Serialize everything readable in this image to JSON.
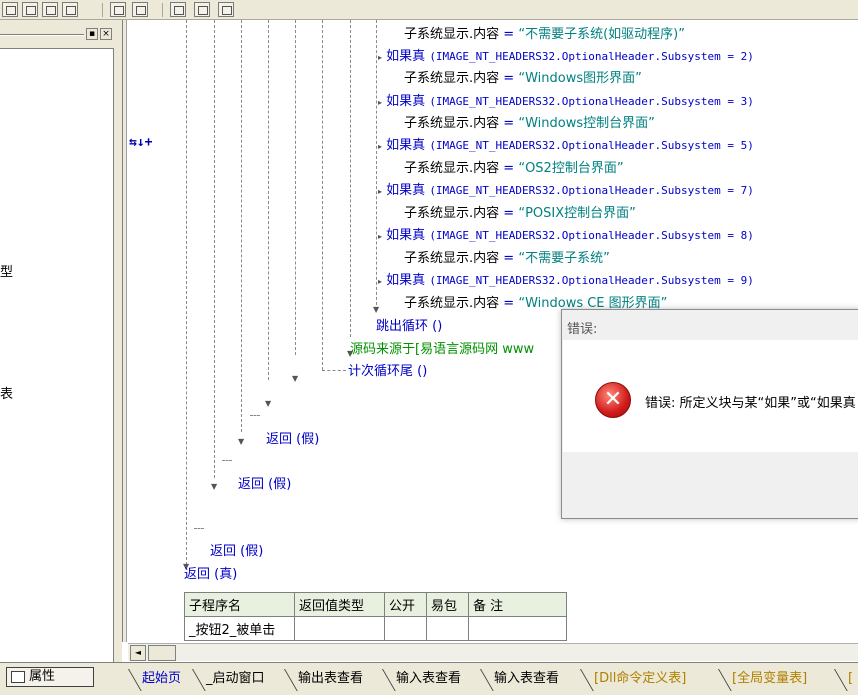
{
  "left_panel": {
    "tree_fragments": [
      "型",
      "表"
    ]
  },
  "gutter": {
    "marker": "⇆↓+"
  },
  "code": {
    "lines": [
      {
        "kind": "assign",
        "lhs": "子系统显示.内容",
        "op": "=",
        "rhs": "“不需要子系统(如驱动程序)”"
      },
      {
        "kind": "if",
        "kw": "如果真",
        "cond": "(IMAGE_NT_HEADERS32.OptionalHeader.Subsystem = 2)"
      },
      {
        "kind": "assign",
        "lhs": "子系统显示.内容",
        "op": "=",
        "rhs": "“Windows图形界面”"
      },
      {
        "kind": "if",
        "kw": "如果真",
        "cond": "(IMAGE_NT_HEADERS32.OptionalHeader.Subsystem = 3)"
      },
      {
        "kind": "assign",
        "lhs": "子系统显示.内容",
        "op": "=",
        "rhs": "“Windows控制台界面”"
      },
      {
        "kind": "if",
        "kw": "如果真",
        "cond": "(IMAGE_NT_HEADERS32.OptionalHeader.Subsystem = 5)"
      },
      {
        "kind": "assign",
        "lhs": "子系统显示.内容",
        "op": "=",
        "rhs": "“OS2控制台界面”"
      },
      {
        "kind": "if",
        "kw": "如果真",
        "cond": "(IMAGE_NT_HEADERS32.OptionalHeader.Subsystem = 7)"
      },
      {
        "kind": "assign",
        "lhs": "子系统显示.内容",
        "op": "=",
        "rhs": "“POSIX控制台界面”"
      },
      {
        "kind": "if",
        "kw": "如果真",
        "cond": "(IMAGE_NT_HEADERS32.OptionalHeader.Subsystem = 8)"
      },
      {
        "kind": "assign",
        "lhs": "子系统显示.内容",
        "op": "=",
        "rhs": "“不需要子系统”"
      },
      {
        "kind": "if",
        "kw": "如果真",
        "cond": "(IMAGE_NT_HEADERS32.OptionalHeader.Subsystem = 9)"
      },
      {
        "kind": "assign",
        "lhs": "子系统显示.内容",
        "op": "=",
        "rhs": "“Windows CE 图形界面”"
      }
    ],
    "break_loop": "跳出循环 ()",
    "comment": "源码来源于[易语言源码网 www",
    "loop_end": "计次循环尾 ()",
    "return_false_1": "返回 (假)",
    "return_false_2": "返回 (假)",
    "return_false_3": "返回 (假)",
    "return_true": "返回 (真)"
  },
  "sub_table": {
    "headers": [
      "子程序名",
      "返回值类型",
      "公开",
      "易包",
      "备 注"
    ],
    "row": [
      "_按钮2_被单击",
      "",
      "",
      "",
      ""
    ]
  },
  "scrollbar": {
    "left_arrow": "◄"
  },
  "bottom": {
    "props_label": "属性",
    "tabs": [
      "起始页",
      "_启动窗口",
      "输出表查看",
      "输入表查看",
      "输入表查看",
      "[Dll命令定义表]",
      "[全局变量表]",
      "["
    ]
  },
  "dialog": {
    "title": "错误:",
    "icon": "error-icon",
    "message": "错误: 所定义块与某“如果”或“如果真"
  },
  "colors": {
    "keyword": "#0000c8",
    "string": "#008080",
    "comment": "#009000",
    "error": "#d01a1a"
  }
}
